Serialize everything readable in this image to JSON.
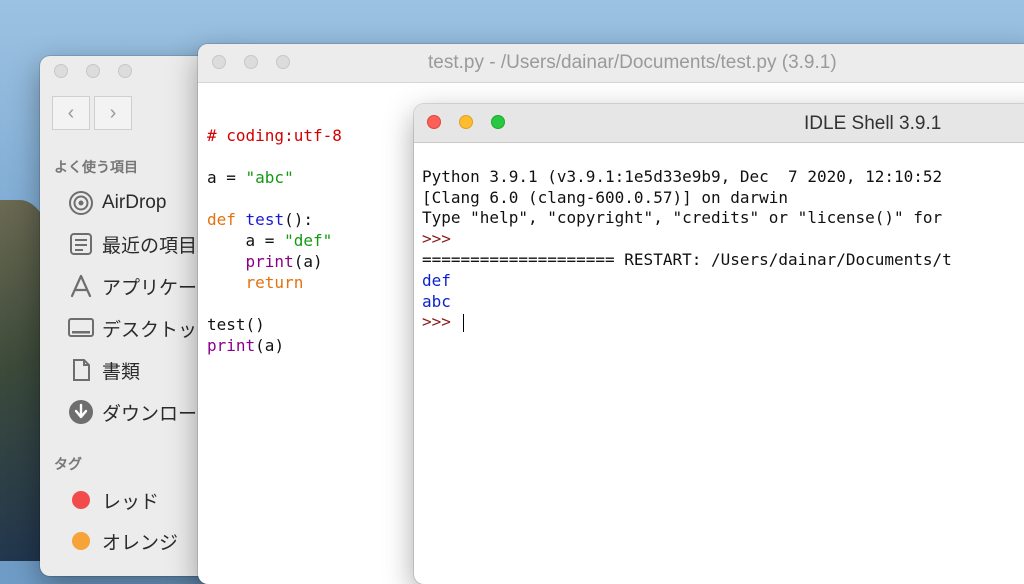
{
  "finder": {
    "section_favorites": "よく使う項目",
    "items": [
      {
        "label": "AirDrop",
        "icon": "airdrop-icon"
      },
      {
        "label": "最近の項目",
        "icon": "recents-icon"
      },
      {
        "label": "アプリケー",
        "icon": "applications-icon"
      },
      {
        "label": "デスクトッ",
        "icon": "desktop-icon"
      },
      {
        "label": "書類",
        "icon": "documents-icon"
      },
      {
        "label": "ダウンロー",
        "icon": "downloads-icon"
      }
    ],
    "section_tags": "タグ",
    "tags": [
      {
        "label": "レッド",
        "color": "#f24b4b"
      },
      {
        "label": "オレンジ",
        "color": "#f6a33a"
      }
    ],
    "nav_back": "‹",
    "nav_forward": "›"
  },
  "editor": {
    "title": "test.py - /Users/dainar/Documents/test.py (3.9.1)",
    "lines": {
      "l1": "# coding:utf-8",
      "l3a": "a = ",
      "l3b": "\"abc\"",
      "l5a": "def",
      "l5b": "test",
      "l5c": "():",
      "l6a": "    a = ",
      "l6b": "\"def\"",
      "l7a": "    ",
      "l7b": "print",
      "l7c": "(a)",
      "l8a": "    ",
      "l8b": "return",
      "l10": "test()",
      "l11a": "print",
      "l11b": "(a)"
    }
  },
  "shell": {
    "title": "IDLE Shell 3.9.1",
    "lines": {
      "l1": "Python 3.9.1 (v3.9.1:1e5d33e9b9, Dec  7 2020, 12:10:52",
      "l2": "[Clang 6.0 (clang-600.0.57)] on darwin",
      "l3": "Type \"help\", \"copyright\", \"credits\" or \"license()\" for",
      "l4": ">>>",
      "l5": "==================== RESTART: /Users/dainar/Documents/t",
      "l6": "def",
      "l7": "abc",
      "l8": ">>> "
    },
    "colors": {
      "close": "#fe5f57",
      "minimize": "#febc2e",
      "zoom": "#28c840"
    }
  }
}
